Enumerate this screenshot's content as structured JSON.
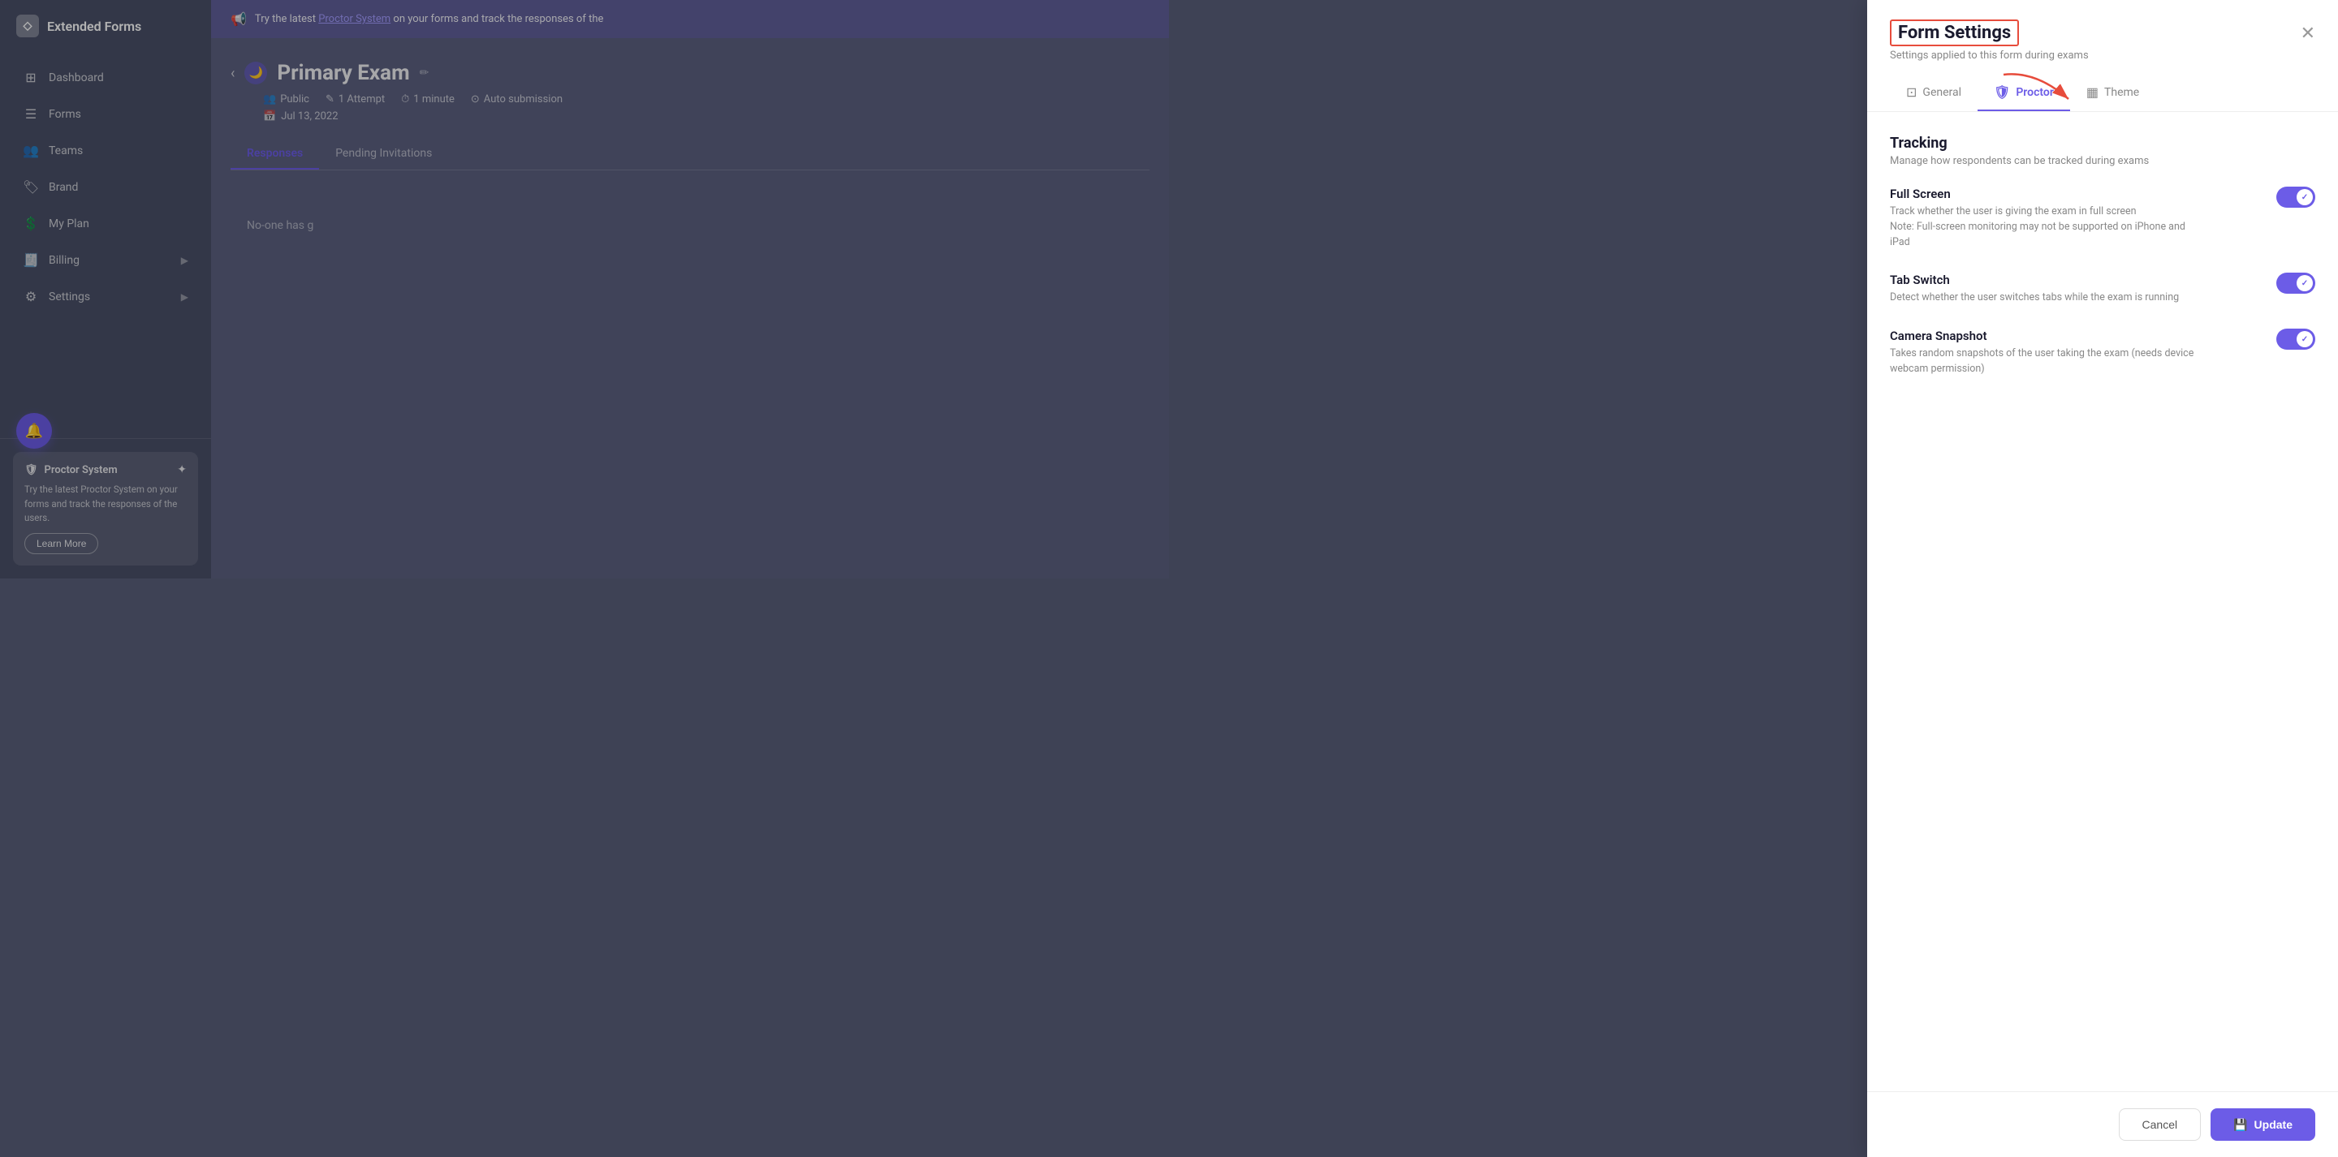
{
  "app": {
    "name": "Extended Forms",
    "logo_icon": "◇"
  },
  "sidebar": {
    "nav_items": [
      {
        "id": "dashboard",
        "label": "Dashboard",
        "icon": "▦"
      },
      {
        "id": "forms",
        "label": "Forms",
        "icon": "☰"
      },
      {
        "id": "teams",
        "label": "Teams",
        "icon": "👥"
      },
      {
        "id": "brand",
        "label": "Brand",
        "icon": "$"
      },
      {
        "id": "my-plan",
        "label": "My Plan",
        "icon": "$"
      },
      {
        "id": "billing",
        "label": "Billing",
        "icon": "▤"
      },
      {
        "id": "settings",
        "label": "Settings",
        "icon": "⚙"
      }
    ],
    "proctor_card": {
      "title": "Proctor System",
      "sparkle_icon": "✦",
      "shield_icon": "🛡",
      "description": "Try the latest Proctor System on your forms and track the responses of the users.",
      "learn_more_label": "Learn More"
    }
  },
  "banner": {
    "icon": "📢",
    "text": "Try the latest ",
    "link_text": "Proctor System",
    "text_after": " on your forms and track the responses of the"
  },
  "form": {
    "title": "Primary Exam",
    "visibility": "Public",
    "attempts": "1 Attempt",
    "duration": "1 minute",
    "submission": "Auto submission",
    "date": "Jul 13, 2022",
    "tabs": [
      {
        "id": "responses",
        "label": "Responses"
      },
      {
        "id": "pending",
        "label": "Pending Invitations"
      }
    ],
    "active_tab": "responses",
    "empty_message": "No-one has g"
  },
  "panel": {
    "title": "Form Settings",
    "subtitle": "Settings applied to this form during exams",
    "close_icon": "✕",
    "tabs": [
      {
        "id": "general",
        "label": "General",
        "icon": "⊡"
      },
      {
        "id": "proctor",
        "label": "Proctor",
        "icon": "🛡",
        "active": true
      },
      {
        "id": "theme",
        "label": "Theme",
        "icon": "▦"
      }
    ],
    "tracking": {
      "title": "Tracking",
      "description": "Manage how respondents can be tracked during exams",
      "items": [
        {
          "id": "full-screen",
          "title": "Full Screen",
          "description": "Track whether the user is giving the exam in full screen",
          "note": "Note: Full-screen monitoring may not be supported on iPhone and iPad",
          "enabled": true
        },
        {
          "id": "tab-switch",
          "title": "Tab Switch",
          "description": "Detect whether the user switches tabs while the exam is running",
          "note": "",
          "enabled": true
        },
        {
          "id": "camera-snapshot",
          "title": "Camera Snapshot",
          "description": "Takes random snapshots of the user taking the exam (needs device webcam permission)",
          "note": "",
          "enabled": true
        }
      ]
    },
    "footer": {
      "cancel_label": "Cancel",
      "update_label": "Update",
      "save_icon": "💾"
    }
  },
  "colors": {
    "accent": "#6c5ce7",
    "danger": "#e74c3c",
    "toggle_on": "#6c5ce7"
  }
}
